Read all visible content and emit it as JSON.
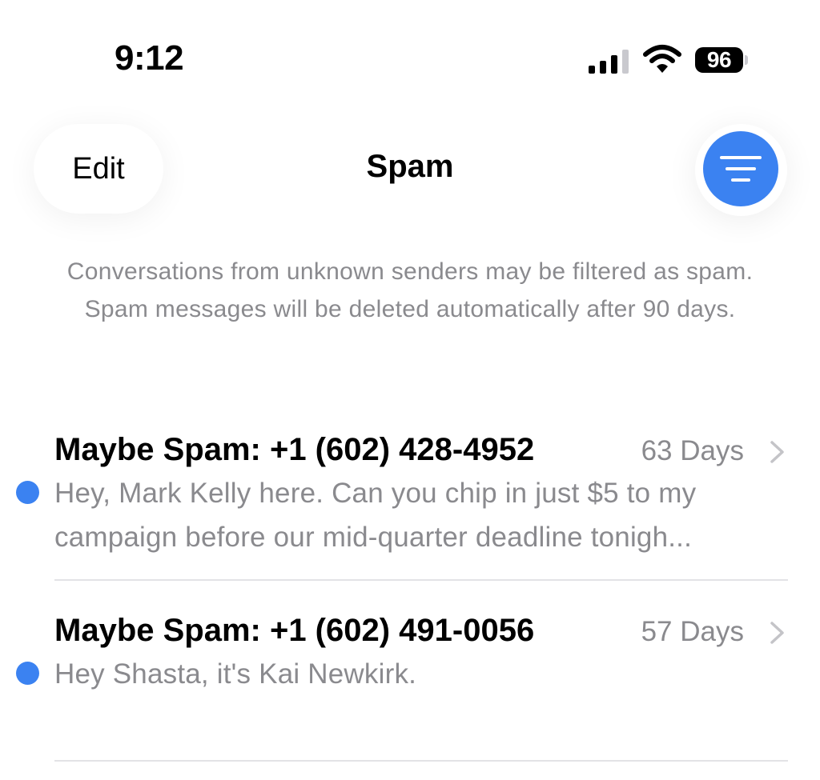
{
  "status_bar": {
    "time": "9:12",
    "battery_level": "96",
    "signal_bars_active": 3,
    "signal_bars_total": 4,
    "icons": [
      "signal-icon",
      "wifi-icon",
      "battery-icon"
    ]
  },
  "nav": {
    "edit_label": "Edit",
    "title": "Spam",
    "filter_icon": "filter-icon"
  },
  "info_text": "Conversations from unknown senders may be filtered as spam. Spam messages will be deleted automatically after 90 days.",
  "conversations": [
    {
      "sender": "Maybe Spam: +1 (602) 428-4952",
      "date": "63 Days",
      "preview_line1": "Hey, Mark Kelly here. Can you chip in just $5 to my",
      "preview_line2": "campaign before our mid-quarter deadline tonigh...",
      "unread": true
    },
    {
      "sender": "Maybe Spam: +1 (602) 491-0056",
      "date": "57 Days",
      "preview_line1": "Hey Shasta, it's Kai Newkirk.",
      "unread": true
    }
  ],
  "colors": {
    "accent": "#3b82f1",
    "secondary_text": "#8a8a8e",
    "separator": "#e3e3e6"
  }
}
